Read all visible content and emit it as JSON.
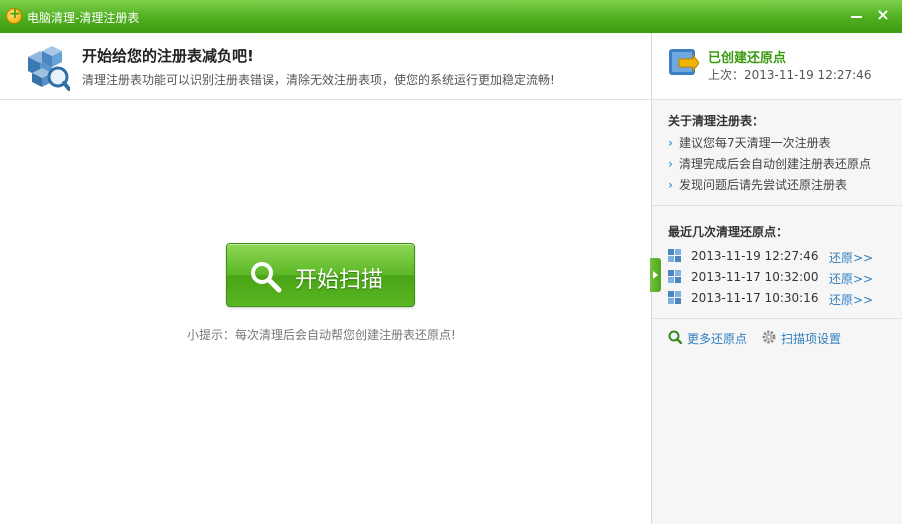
{
  "window": {
    "title": "电脑清理-清理注册表",
    "minimize_icon": "minimize-icon",
    "close_label": "×"
  },
  "header": {
    "title": "开始给您的注册表减负吧!",
    "subtitle": "清理注册表功能可以识别注册表错误，清除无效注册表项，使您的系统运行更加稳定流畅!",
    "icon": "registry-cubes-icon"
  },
  "main": {
    "scan_button_label": "开始扫描",
    "scan_button_icon": "magnifier-icon",
    "tip": "小提示：每次清理后会自动帮您创建注册表还原点!"
  },
  "sidebar": {
    "restore_status": {
      "title": "已创建还原点",
      "last_time": "上次：2013-11-19 12:27:46",
      "icon": "restore-point-icon"
    },
    "about": {
      "title": "关于清理注册表：",
      "items": [
        "建议您每7天清理一次注册表",
        "清理完成后会自动创建注册表还原点",
        "发现问题后请先尝试还原注册表"
      ]
    },
    "recent": {
      "title": "最近几次清理还原点：",
      "points": [
        {
          "time": "2013-11-19 12:27:46",
          "link": "还原>>"
        },
        {
          "time": "2013-11-17 10:32:00",
          "link": "还原>>"
        },
        {
          "time": "2013-11-17 10:30:16",
          "link": "还原>>"
        }
      ]
    },
    "links": {
      "more_restore_points": "更多还原点",
      "scan_settings": "扫描项设置"
    }
  },
  "colors": {
    "titlebar_green": "#4fae1e",
    "accent_green": "#3a9a10",
    "link_blue": "#2f7fc0"
  }
}
